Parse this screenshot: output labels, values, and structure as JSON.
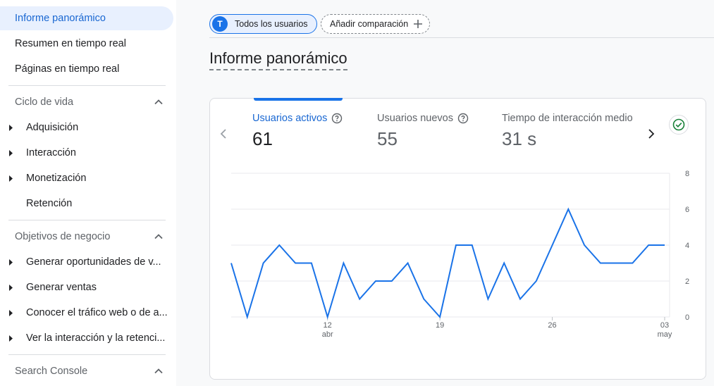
{
  "sidebar": {
    "active_item": "Informe panorámico",
    "items": [
      "Resumen en tiempo real",
      "Páginas en tiempo real"
    ],
    "sections": [
      {
        "title": "Ciclo de vida",
        "items": [
          "Adquisición",
          "Interacción",
          "Monetización",
          "Retención"
        ]
      },
      {
        "title": "Objetivos de negocio",
        "items": [
          "Generar oportunidades de v...",
          "Generar ventas",
          "Conocer el tráfico web o de a...",
          "Ver la interacción y la retenci..."
        ]
      },
      {
        "title": "Search Console",
        "items": []
      }
    ]
  },
  "header": {
    "user_chip": {
      "avatar_letter": "T",
      "label": "Todos los usuarios"
    },
    "compare_chip": {
      "label": "Añadir comparación"
    }
  },
  "page_title": "Informe panorámico",
  "metrics": [
    {
      "label": "Usuarios activos",
      "value": "61",
      "active": true
    },
    {
      "label": "Usuarios nuevos",
      "value": "55",
      "active": false
    },
    {
      "label": "Tiempo de interacción medio",
      "value": "31 s",
      "active": false
    }
  ],
  "icons": {
    "prev": "chevron-left-icon",
    "next": "chevron-right-icon",
    "help": "help-circle-icon",
    "check": "check-circle-icon",
    "collapse": "chevron-up-icon",
    "expand": "triangle-right-icon",
    "add": "plus-icon"
  },
  "colors": {
    "accent": "#1a73e8",
    "active_bg": "#e8f0fe",
    "check": "#188038"
  },
  "chart_data": {
    "type": "line",
    "series": [
      {
        "values": [
          3,
          0,
          3,
          4,
          3,
          3,
          0,
          3,
          1,
          2,
          2,
          3,
          1,
          0,
          4,
          4,
          1,
          3,
          1,
          2,
          4,
          6,
          4,
          3,
          3,
          3,
          4,
          4
        ]
      }
    ],
    "x_ticks": [
      {
        "index": 6,
        "label": "12",
        "sublabel": "abr"
      },
      {
        "index": 13,
        "label": "19",
        "sublabel": ""
      },
      {
        "index": 20,
        "label": "26",
        "sublabel": ""
      },
      {
        "index": 27,
        "label": "03",
        "sublabel": "may"
      }
    ],
    "y_ticks": [
      "0",
      "2",
      "4",
      "6",
      "8"
    ],
    "ylim": [
      0,
      8
    ],
    "y_axis_position": "right",
    "grid": true,
    "line_color": "#1a73e8"
  }
}
